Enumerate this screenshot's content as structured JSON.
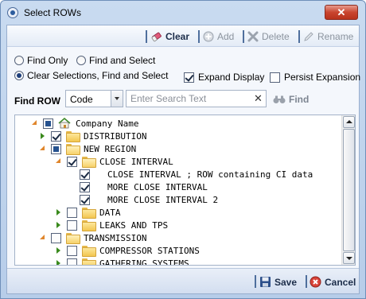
{
  "window": {
    "title": "Select ROWs",
    "close_label": "✕"
  },
  "toolbar": {
    "clear_label": "Clear",
    "add_label": "Add",
    "delete_label": "Delete",
    "rename_label": "Rename"
  },
  "options": {
    "find_only": "Find Only",
    "find_and_select": "Find and Select",
    "clear_find_select": "Clear Selections, Find and Select",
    "expand_display": "Expand Display",
    "persist_expansion": "Persist Expansion",
    "selected_mode": "clear_find_select",
    "expand_display_checked": true,
    "persist_expansion_checked": false
  },
  "find": {
    "label": "Find ROW",
    "field_value": "Code",
    "search_placeholder": "Enter Search Text",
    "search_value": "",
    "find_label": "Find"
  },
  "tree": {
    "items": [
      {
        "label": "Company Name",
        "icon": "home-icon",
        "expander": "expanded",
        "check": "partial"
      },
      {
        "label": "DISTRIBUTION",
        "icon": "folder-icon",
        "expander": "collapsed",
        "check": "checked"
      },
      {
        "label": "NEW REGION",
        "icon": "folder-open-icon",
        "expander": "expanded",
        "check": "partial"
      },
      {
        "label": "CLOSE INTERVAL",
        "icon": "folder-open-icon",
        "expander": "expanded",
        "check": "checked"
      },
      {
        "label": "CLOSE INTERVAL ; ROW containing CI data",
        "icon": "",
        "expander": "none",
        "check": "checked"
      },
      {
        "label": "MORE CLOSE INTERVAL",
        "icon": "",
        "expander": "none",
        "check": "checked"
      },
      {
        "label": "MORE CLOSE INTERVAL 2",
        "icon": "",
        "expander": "none",
        "check": "checked"
      },
      {
        "label": "DATA",
        "icon": "folder-icon",
        "expander": "collapsed",
        "check": "unchecked"
      },
      {
        "label": "LEAKS AND TPS",
        "icon": "folder-icon",
        "expander": "collapsed",
        "check": "unchecked"
      },
      {
        "label": "TRANSMISSION",
        "icon": "folder-open-icon",
        "expander": "expanded",
        "check": "unchecked"
      },
      {
        "label": "COMPRESSOR STATIONS",
        "icon": "folder-icon",
        "expander": "collapsed",
        "check": "unchecked"
      },
      {
        "label": "GATHERING SYSTEMS",
        "icon": "folder-icon",
        "expander": "collapsed",
        "check": "unchecked"
      }
    ]
  },
  "footer": {
    "save_label": "Save",
    "cancel_label": "Cancel"
  },
  "colors": {
    "window_border": "#6f8fb9",
    "close_button": "#c9452f",
    "expander_expanded": "#e0862c",
    "expander_collapsed": "#3a8a1d",
    "partial_check": "#26528f"
  }
}
